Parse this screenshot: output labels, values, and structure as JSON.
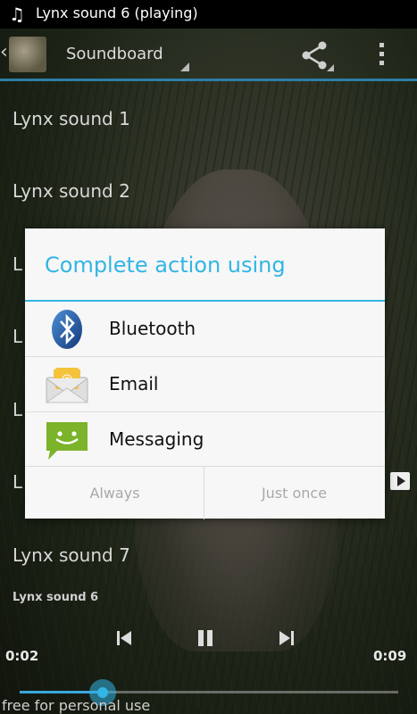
{
  "status_bar": {
    "note_icon": "music-note-icon",
    "title": "Lynx sound 6 (playing)"
  },
  "action_bar": {
    "spinner_label": "Soundboard",
    "share_icon": "share-icon",
    "overflow_icon": "overflow-menu-icon",
    "accent_color": "#2d7ea5"
  },
  "sound_list": {
    "items": [
      {
        "label": "Lynx sound 1"
      },
      {
        "label": "Lynx sound 2"
      },
      {
        "label": "L"
      },
      {
        "label": "L"
      },
      {
        "label": "L"
      },
      {
        "label": "L"
      },
      {
        "label": "Lynx sound 7"
      }
    ]
  },
  "player": {
    "now_playing": "Lynx sound 6",
    "elapsed": "0:02",
    "total": "0:09",
    "progress_fraction": 0.22,
    "watermark": "free for personal use"
  },
  "dialog": {
    "title": "Complete action using",
    "title_color": "#33b5e5",
    "apps": [
      {
        "label": "Bluetooth",
        "icon": "bluetooth-icon"
      },
      {
        "label": "Email",
        "icon": "email-icon"
      },
      {
        "label": "Messaging",
        "icon": "messaging-icon"
      }
    ],
    "buttons": {
      "always": "Always",
      "just_once": "Just once"
    }
  }
}
